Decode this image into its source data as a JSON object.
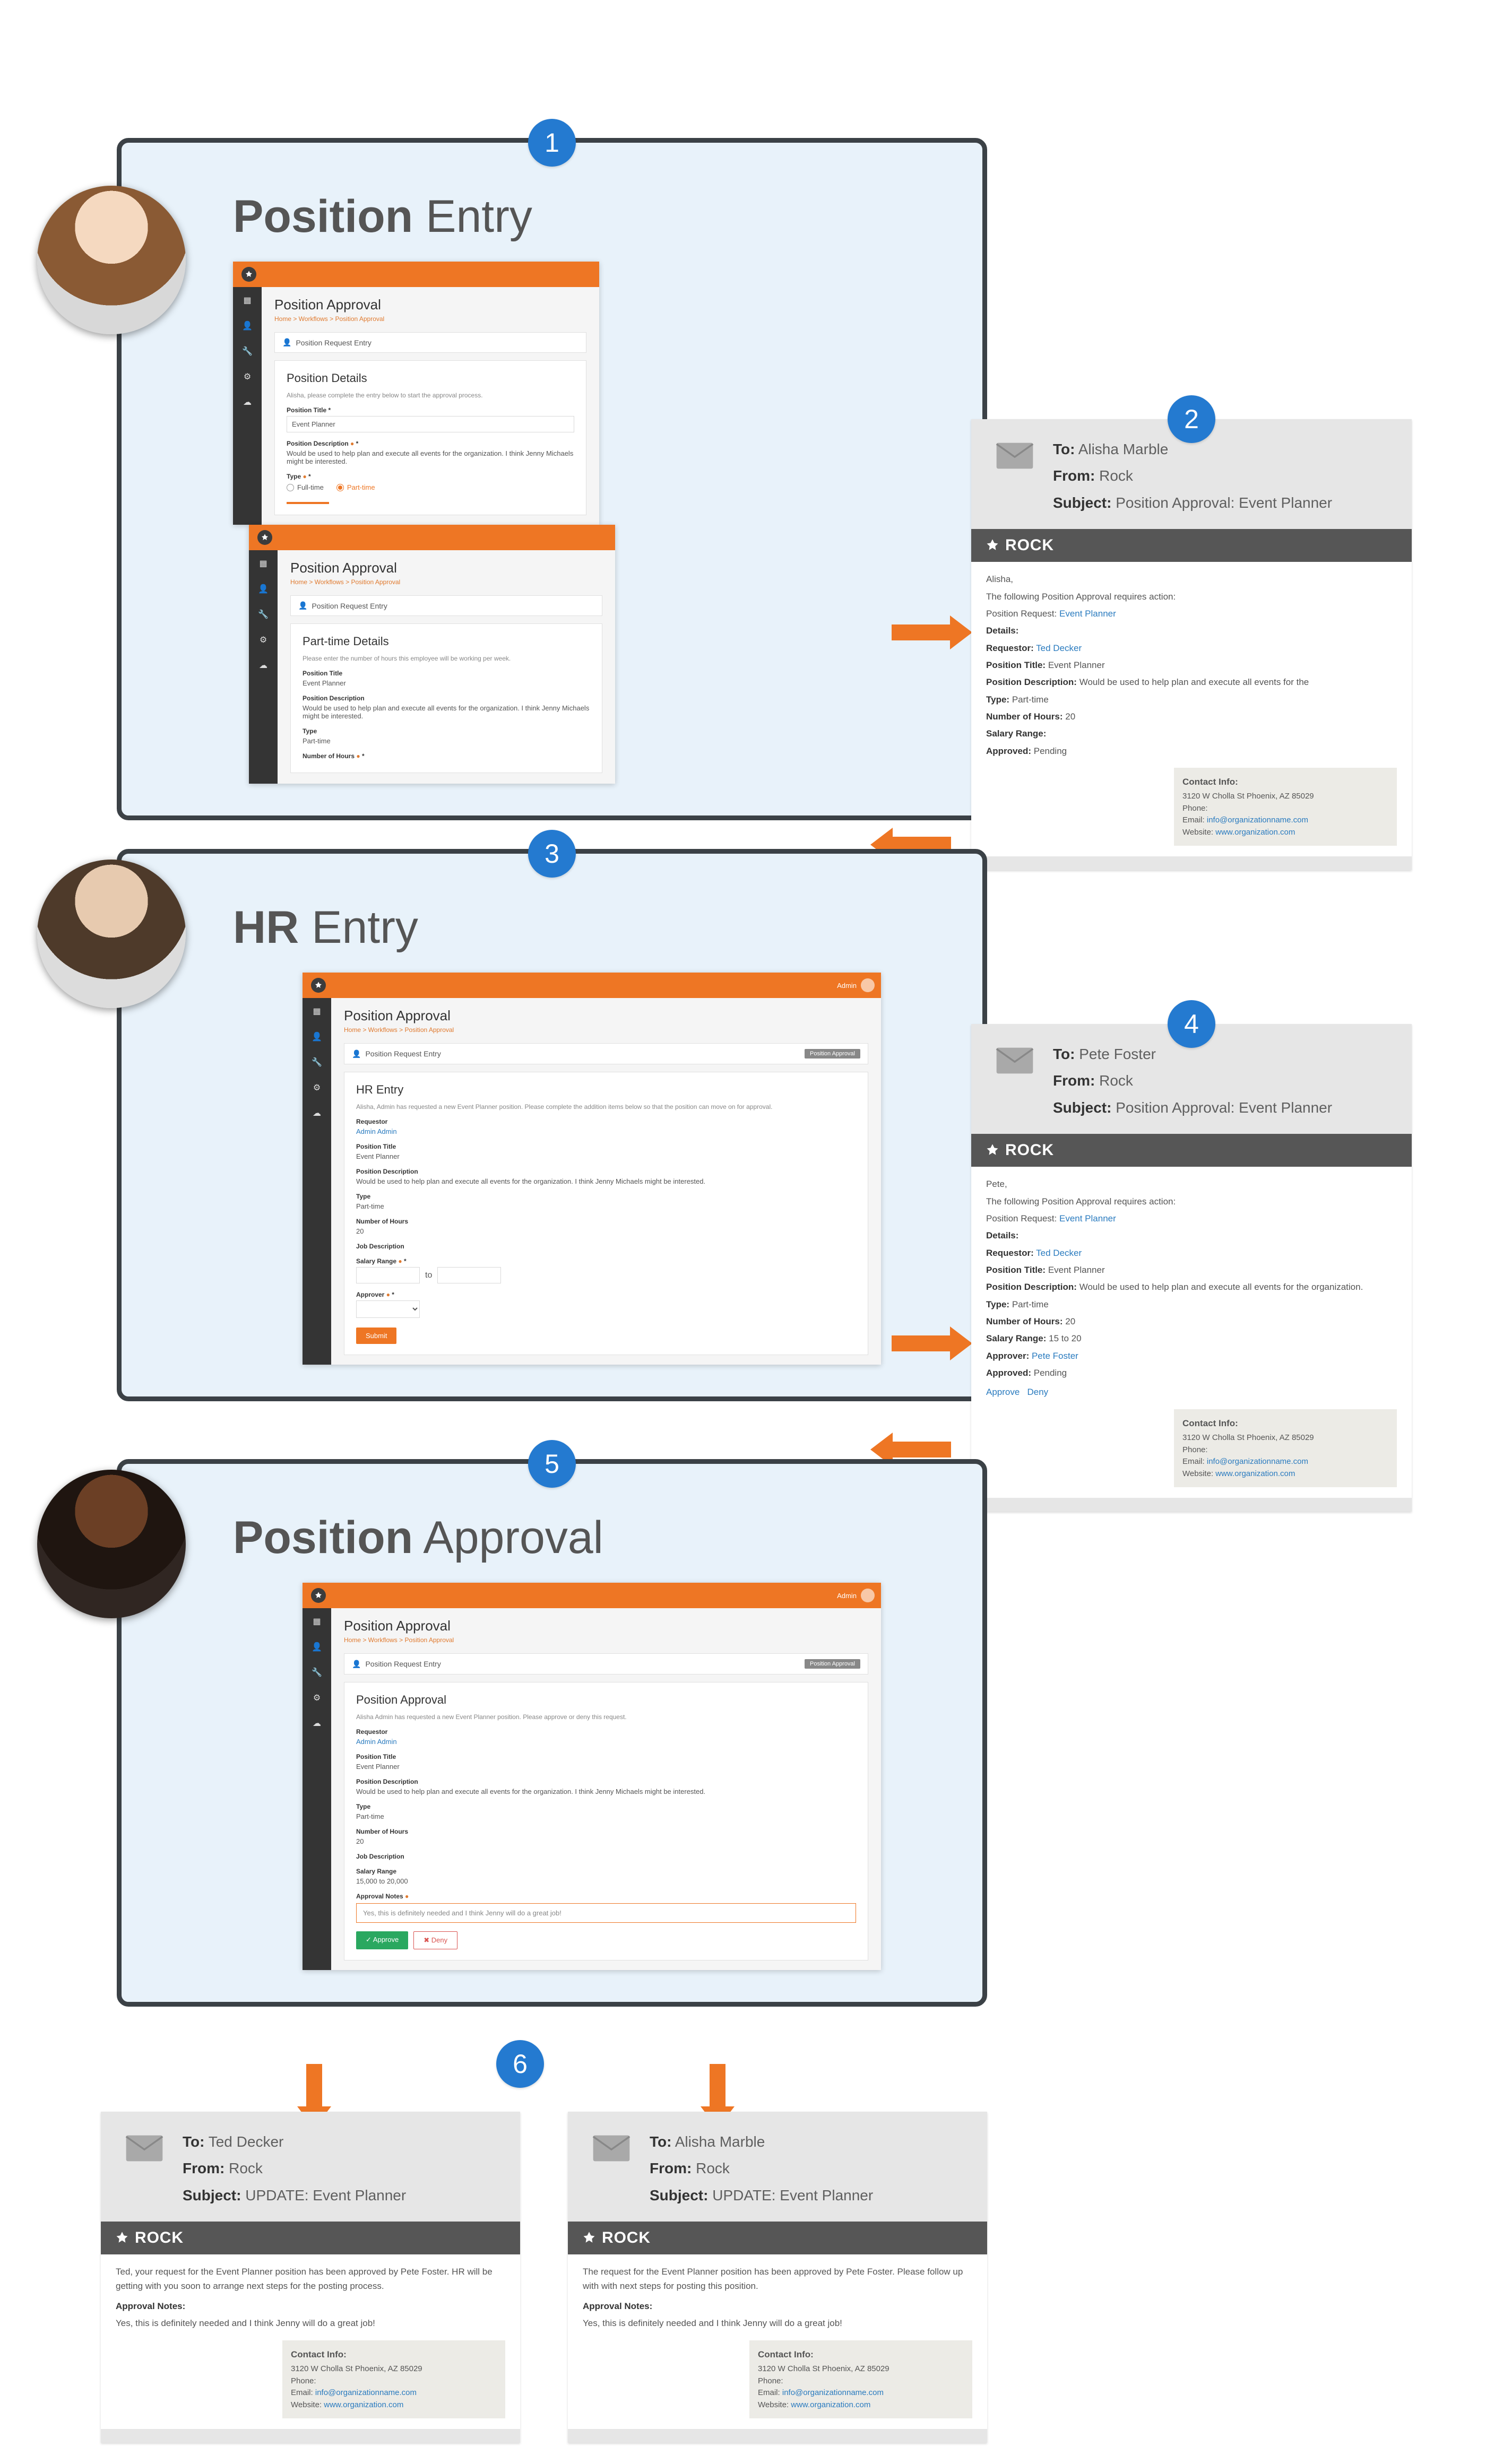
{
  "colors": {
    "accent": "#ee7624",
    "badge": "#247ad0",
    "rockbar": "#565656"
  },
  "steps": {
    "s1": {
      "num": "1",
      "title_bold": "Position",
      "title_rest": " Entry"
    },
    "s2": {
      "num": "2"
    },
    "s3": {
      "num": "3",
      "title_bold": "HR",
      "title_rest": " Entry"
    },
    "s4": {
      "num": "4"
    },
    "s5": {
      "num": "5",
      "title_bold": "Position",
      "title_rest": " Approval"
    },
    "s6": {
      "num": "6"
    }
  },
  "app": {
    "page_title": "Position Approval",
    "crumbs": "Home > Workflows > Position Approval",
    "entry_label": "Position Request Entry",
    "entry_label_icon": "person-icon",
    "pill_label": "Position Approval"
  },
  "card1a": {
    "h2": "Position Details",
    "help": "Alisha, please complete the entry below to start the approval process.",
    "title_lbl": "Position Title *",
    "title_val": "Event Planner",
    "desc_lbl": "Position Description",
    "desc_val": "Would be used to help plan and execute all events for the organization. I think Jenny Michaels might be interested.",
    "type_lbl": "Type",
    "type_full": "Full-time",
    "type_part": "Part-time"
  },
  "card1b": {
    "h2": "Part-time Details",
    "help": "Please enter the number of hours this employee will be working per week.",
    "title_lbl": "Position Title",
    "title_val": "Event Planner",
    "desc_lbl": "Position Description",
    "desc_val": "Would be used to help plan and execute all events for the organization. I think Jenny Michaels might be interested.",
    "type_lbl": "Type",
    "type_val": "Part-time",
    "hours_lbl": "Number of Hours"
  },
  "email2": {
    "to": "Alisha Marble",
    "from": "Rock",
    "subject": "Position Approval: Event Planner",
    "greeting": "Alisha,",
    "lead": "The following Position Approval requires action:",
    "req_lbl": "Position Request:",
    "req_val": "Event Planner",
    "details_lbl": "Details:",
    "d_requestor_lbl": "Requestor:",
    "d_requestor_val": "Ted Decker",
    "d_title_lbl": "Position Title:",
    "d_title_val": "Event Planner",
    "d_desc_lbl": "Position Description:",
    "d_desc_val": "Would be used to help plan and execute all events for the",
    "d_type_lbl": "Type:",
    "d_type_val": "Part-time",
    "d_hours_lbl": "Number of Hours:",
    "d_hours_val": "20",
    "d_salary_lbl": "Salary Range:",
    "d_salary_val": "",
    "d_approved_lbl": "Approved:",
    "d_approved_val": "Pending"
  },
  "contact": {
    "heading": "Contact Info:",
    "addr": "3120 W Cholla St Phoenix, AZ 85029",
    "phone_lbl": "Phone:",
    "email_lbl": "Email:",
    "email_val": "info@organizationname.com",
    "web_lbl": "Website:",
    "web_val": "www.organization.com"
  },
  "card3": {
    "h2": "HR Entry",
    "help": "Alisha, Admin has requested a new Event Planner position. Please complete the addition items below so that the position can move on for approval.",
    "req_lbl": "Requestor",
    "req_val": "Admin Admin",
    "title_lbl": "Position Title",
    "title_val": "Event Planner",
    "desc_lbl": "Position Description",
    "desc_val": "Would be used to help plan and execute all events for the organization. I think Jenny Michaels might be interested.",
    "type_lbl": "Type",
    "type_val": "Part-time",
    "hours_lbl": "Number of Hours",
    "hours_val": "20",
    "jd_lbl": "Job Description",
    "range_lbl": "Salary Range",
    "range_val": "to",
    "approver_lbl": "Approver",
    "submit": "Submit"
  },
  "email4": {
    "to": "Pete Foster",
    "from": "Rock",
    "subject": "Position Approval: Event Planner",
    "greeting": "Pete,",
    "lead": "The following Position Approval requires action:",
    "req_lbl": "Position Request:",
    "req_val": "Event Planner",
    "details_lbl": "Details:",
    "d_requestor_lbl": "Requestor:",
    "d_requestor_val": "Ted Decker",
    "d_title_lbl": "Position Title:",
    "d_title_val": "Event Planner",
    "d_desc_lbl": "Position Description:",
    "d_desc_val": "Would be used to help plan and execute all events for the organization.",
    "d_type_lbl": "Type:",
    "d_type_val": "Part-time",
    "d_hours_lbl": "Number of Hours:",
    "d_hours_val": "20",
    "d_salary_lbl": "Salary Range:",
    "d_salary_val": "15 to 20",
    "d_approver_lbl": "Approver:",
    "d_approver_val": "Pete Foster",
    "d_approved_lbl": "Approved:",
    "d_approved_val": "Pending",
    "approve": "Approve",
    "deny": "Deny"
  },
  "card5": {
    "h2": "Position Approval",
    "help": "Alisha Admin has requested a new Event Planner position. Please approve or deny this request.",
    "req_lbl": "Requestor",
    "req_val": "Admin Admin",
    "title_lbl": "Position Title",
    "title_val": "Event Planner",
    "desc_lbl": "Position Description",
    "desc_val": "Would be used to help plan and execute all events for the organization. I think Jenny Michaels might be interested.",
    "type_lbl": "Type",
    "type_val": "Part-time",
    "hours_lbl": "Number of Hours",
    "hours_val": "20",
    "jd_lbl": "Job Description",
    "range_lbl": "Salary Range",
    "range_val": "15,000 to 20,000",
    "notes_lbl": "Approval Notes",
    "notes_val": "Yes, this is definitely needed and I think Jenny will do a great job!",
    "approve": "Approve",
    "deny": "Deny"
  },
  "email6a": {
    "to": "Ted Decker",
    "from": "Rock",
    "subject": "UPDATE: Event Planner",
    "body": "Ted, your request for the Event Planner position has been approved by Pete Foster. HR will be getting with you soon to arrange next steps for the posting process.",
    "notes_lbl": "Approval Notes:",
    "notes_val": "Yes, this is definitely needed and I think Jenny will do a great job!"
  },
  "email6b": {
    "to": "Alisha Marble",
    "from": "Rock",
    "subject": "UPDATE: Event Planner",
    "body": "The request for the Event Planner position has been approved by Pete Foster. Please follow up with with next steps for posting this position.",
    "notes_lbl": "Approval Notes:",
    "notes_val": "Yes, this is definitely needed and I think Jenny will do a great job!"
  },
  "labels": {
    "to": "To:",
    "from": "From:",
    "subject": "Subject:",
    "rock": "ROCK",
    "user": "Admin"
  }
}
